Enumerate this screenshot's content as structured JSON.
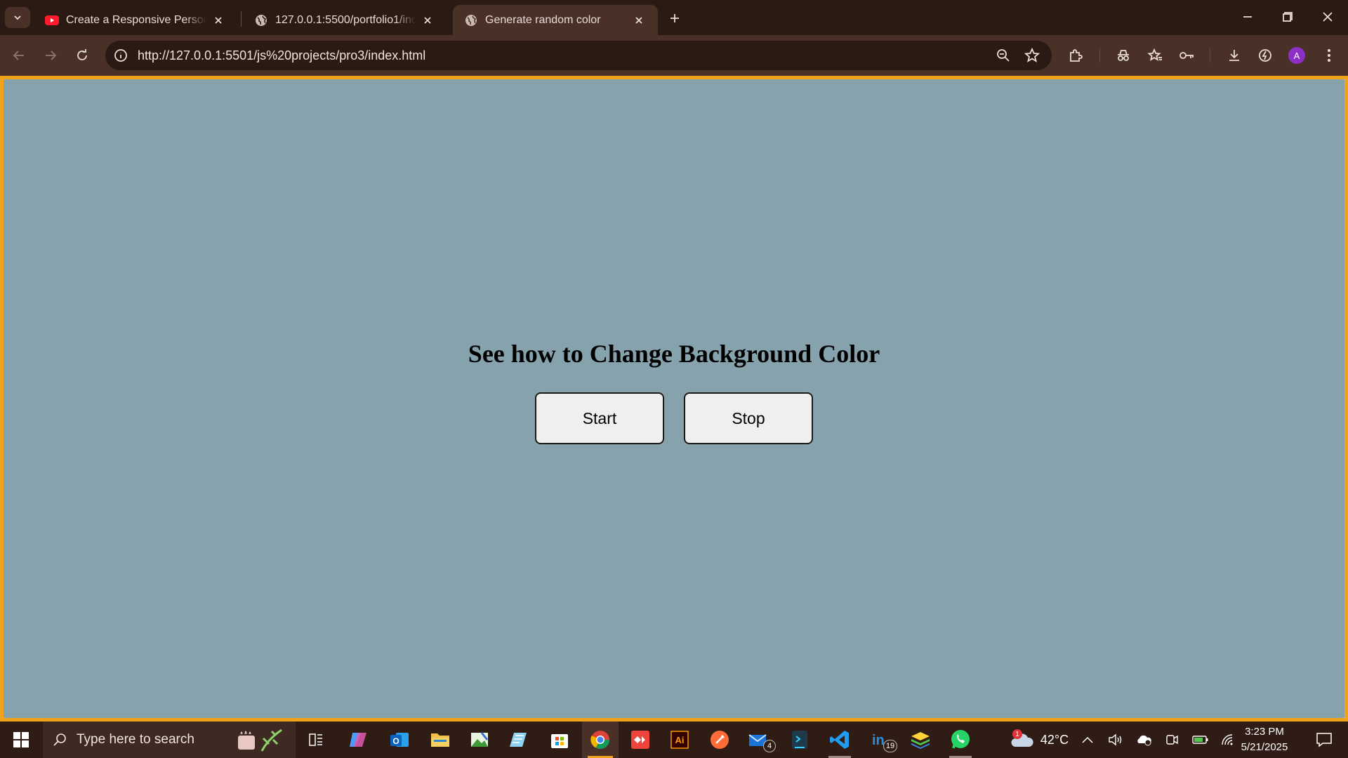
{
  "browser": {
    "tabs": [
      {
        "title": "Create a Responsive Personal P",
        "icon": "youtube-icon"
      },
      {
        "title": "127.0.0.1:5500/portfolio1/index",
        "icon": "globe-icon"
      },
      {
        "title": "Generate random color",
        "icon": "globe-icon",
        "active": true
      }
    ],
    "url": "http://127.0.0.1:5501/js%20projects/pro3/index.html",
    "profile_initial": "A"
  },
  "page": {
    "heading": "See how to Change Background Color",
    "buttons": {
      "start": "Start",
      "stop": "Stop"
    },
    "background_color": "#86a3ad",
    "frame_color": "#f0a21a"
  },
  "taskbar": {
    "search_placeholder": "Type here to search",
    "mail_badge": "4",
    "linkedin_badge": "19",
    "weather_badge": "1",
    "temperature": "42°C",
    "time": "3:23 PM",
    "date": "5/21/2025"
  }
}
